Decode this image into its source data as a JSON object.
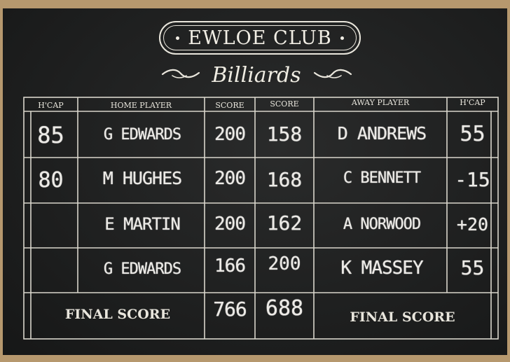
{
  "club": {
    "name": "EWLOE CLUB",
    "subtitle": "Billiards"
  },
  "headers": {
    "hcap_home": "H'CAP",
    "home_player": "HOME PLAYER",
    "score_home": "SCORE",
    "score_away": "SCORE",
    "away_player": "AWAY PLAYER",
    "hcap_away": "H'CAP"
  },
  "rows": [
    {
      "hcap_home": "85",
      "home_player": "G EDWARDS",
      "score_home": "200",
      "score_away": "158",
      "away_player": "D ANDREWS",
      "hcap_away": "55"
    },
    {
      "hcap_home": "80",
      "home_player": "M HUGHES",
      "score_home": "200",
      "score_away": "168",
      "away_player": "C BENNETT",
      "hcap_away": "-15"
    },
    {
      "hcap_home": "",
      "home_player": "E MARTIN",
      "score_home": "200",
      "score_away": "162",
      "away_player": "A NORWOOD",
      "hcap_away": "+20"
    },
    {
      "hcap_home": "",
      "home_player": "G EDWARDS",
      "score_home": "166",
      "score_away": "200",
      "away_player": "K MASSEY",
      "hcap_away": "55"
    }
  ],
  "final": {
    "home_label": "FINAL SCORE",
    "home_total": "766",
    "away_total": "688",
    "away_label": "FINAL SCORE"
  },
  "colors": {
    "slate": "#1e1f1f",
    "chalk": "#eceae6",
    "frame": "#b6986e"
  }
}
